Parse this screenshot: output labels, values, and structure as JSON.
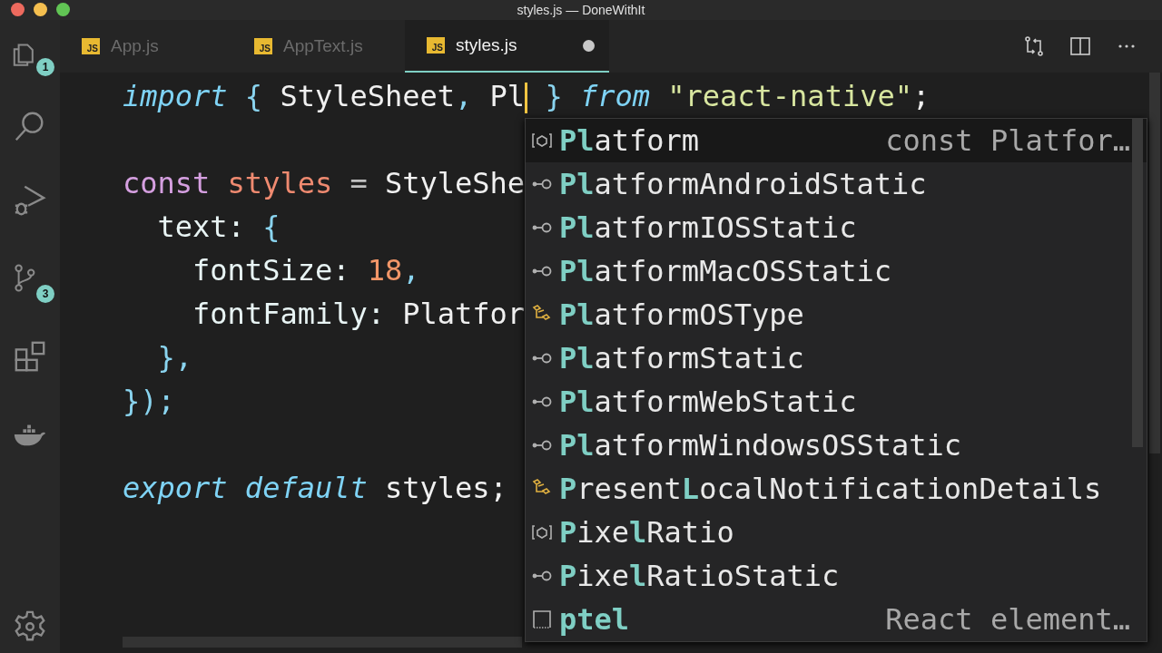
{
  "window": {
    "title": "styles.js — DoneWithIt"
  },
  "activity_bar": [
    {
      "kind": "files",
      "badge": "1"
    },
    {
      "kind": "search"
    },
    {
      "kind": "debug"
    },
    {
      "kind": "git",
      "badge": "3"
    },
    {
      "kind": "extensions"
    },
    {
      "kind": "docker"
    }
  ],
  "tabs": [
    {
      "label": "App.js",
      "badge": "JS",
      "selected": false,
      "dirty": false
    },
    {
      "label": "AppText.js",
      "badge": "JS",
      "selected": false,
      "dirty": false
    },
    {
      "label": "styles.js",
      "badge": "JS",
      "selected": true,
      "dirty": true
    }
  ],
  "editor": {
    "lines": [
      {
        "kind": "code",
        "tokens": [
          {
            "kind": "keyword",
            "text": "import"
          },
          {
            "kind": "brace",
            "text": " {"
          },
          {
            "kind": "ident",
            "text": " StyleSheet"
          },
          {
            "kind": "brace",
            "text": ","
          },
          {
            "kind": "ident",
            "text": " Pl",
            "cursor": true
          },
          {
            "kind": "brace",
            "text": " }"
          },
          {
            "kind": "keyword",
            "text": " from"
          },
          {
            "kind": "string",
            "text": " \"react-native\""
          },
          {
            "kind": "ident",
            "text": ";"
          }
        ]
      },
      {
        "kind": "blank"
      },
      {
        "kind": "code",
        "tokens": [
          {
            "kind": "storage",
            "text": "const"
          },
          {
            "kind": "variable",
            "text": " styles"
          },
          {
            "kind": "op",
            "text": " ="
          },
          {
            "kind": "ident",
            "text": " StyleShe"
          }
        ]
      },
      {
        "kind": "code",
        "tokens": [
          {
            "kind": "prop",
            "text": "  text:"
          },
          {
            "kind": "brace",
            "text": " {"
          }
        ]
      },
      {
        "kind": "code",
        "tokens": [
          {
            "kind": "prop",
            "text": "    fontSize:"
          },
          {
            "kind": "number",
            "text": " 18"
          },
          {
            "kind": "brace",
            "text": ","
          }
        ]
      },
      {
        "kind": "code",
        "tokens": [
          {
            "kind": "prop",
            "text": "    fontFamily:"
          },
          {
            "kind": "ident",
            "text": " Platfor"
          }
        ]
      },
      {
        "kind": "code",
        "tokens": [
          {
            "kind": "brace",
            "text": "  },"
          }
        ]
      },
      {
        "kind": "code",
        "tokens": [
          {
            "kind": "brace",
            "text": "});"
          }
        ]
      },
      {
        "kind": "blank"
      },
      {
        "kind": "code",
        "tokens": [
          {
            "kind": "keyword",
            "text": "export"
          },
          {
            "kind": "keyword",
            "text": " default"
          },
          {
            "kind": "ident",
            "text": " styles;"
          }
        ]
      }
    ]
  },
  "suggestions": [
    {
      "kind": "variable",
      "label": "**Pl**atform",
      "detail": "const Platfor…",
      "selected": true
    },
    {
      "kind": "interface",
      "label": "**Pl**atformAndroidStatic",
      "selected": false
    },
    {
      "kind": "interface",
      "label": "**Pl**atformIOSStatic",
      "selected": false
    },
    {
      "kind": "interface",
      "label": "**Pl**atformMacOSStatic",
      "selected": false
    },
    {
      "kind": "type",
      "label": "**Pl**atformOSType",
      "selected": false
    },
    {
      "kind": "interface",
      "label": "**Pl**atformStatic",
      "selected": false
    },
    {
      "kind": "interface",
      "label": "**Pl**atformWebStatic",
      "selected": false
    },
    {
      "kind": "interface",
      "label": "**Pl**atformWindowsOSStatic",
      "selected": false
    },
    {
      "kind": "type",
      "label": "**P**resent**L**ocalNotificationDetails",
      "selected": false
    },
    {
      "kind": "variable",
      "label": "**P**ixe**l**Ratio",
      "selected": false
    },
    {
      "kind": "interface",
      "label": "**P**ixe**l**RatioStatic",
      "selected": false
    },
    {
      "kind": "snippet",
      "label": "ptel",
      "detail": "React element…",
      "selected": false
    }
  ]
}
